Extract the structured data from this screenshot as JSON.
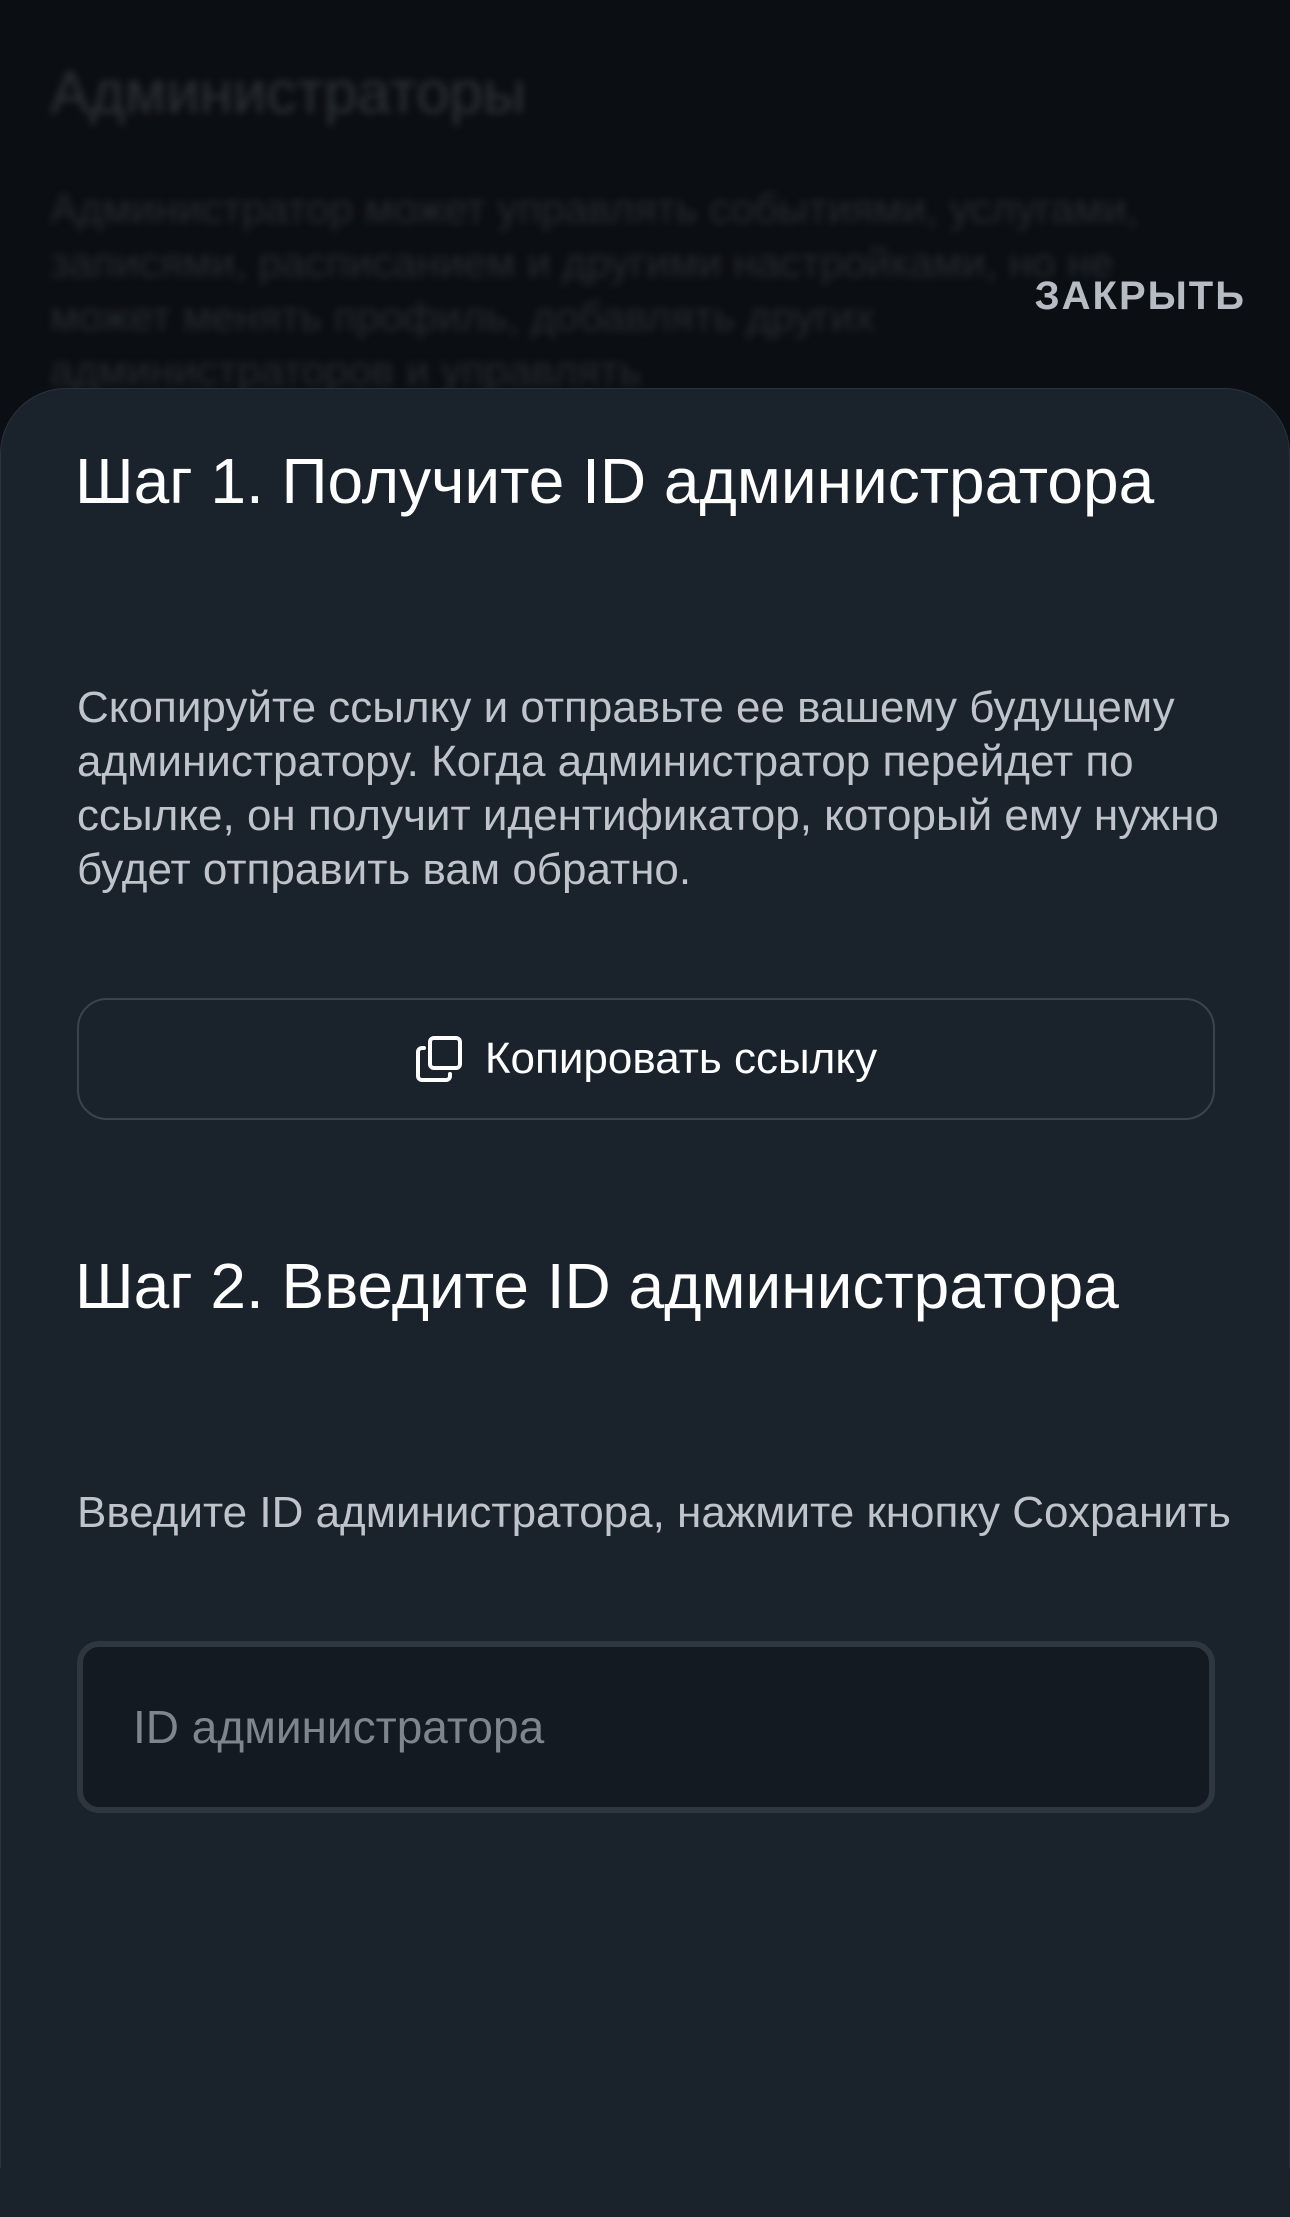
{
  "background": {
    "title": "Администраторы",
    "text": "Администратор может управлять событиями, услугами, записями, расписанием и другими настройками, но не может менять профиль, добавлять других администраторов и управлять"
  },
  "close_label": "ЗАКРЫТЬ",
  "step1": {
    "title": "Шаг 1. Получите ID администратора",
    "description": "Скопируйте ссылку и отправьте ее вашему будущему администратору. Когда администратор перейдет по ссылке, он получит идентификатор, который ему нужно будет отправить вам обратно.",
    "copy_button_label": "Копировать ссылку",
    "copy_icon": "copy-icon"
  },
  "step2": {
    "title": "Шаг 2. Введите ID администратора",
    "description": "Введите ID администратора, нажмите кнопку Сохранить",
    "input_placeholder": "ID администратора",
    "input_value": ""
  },
  "colors": {
    "sheet_background": "#1a222c",
    "page_background": "#0b0e12",
    "text_primary": "#ffffff",
    "text_secondary": "#bfc4ca",
    "border": "#3a434e"
  }
}
